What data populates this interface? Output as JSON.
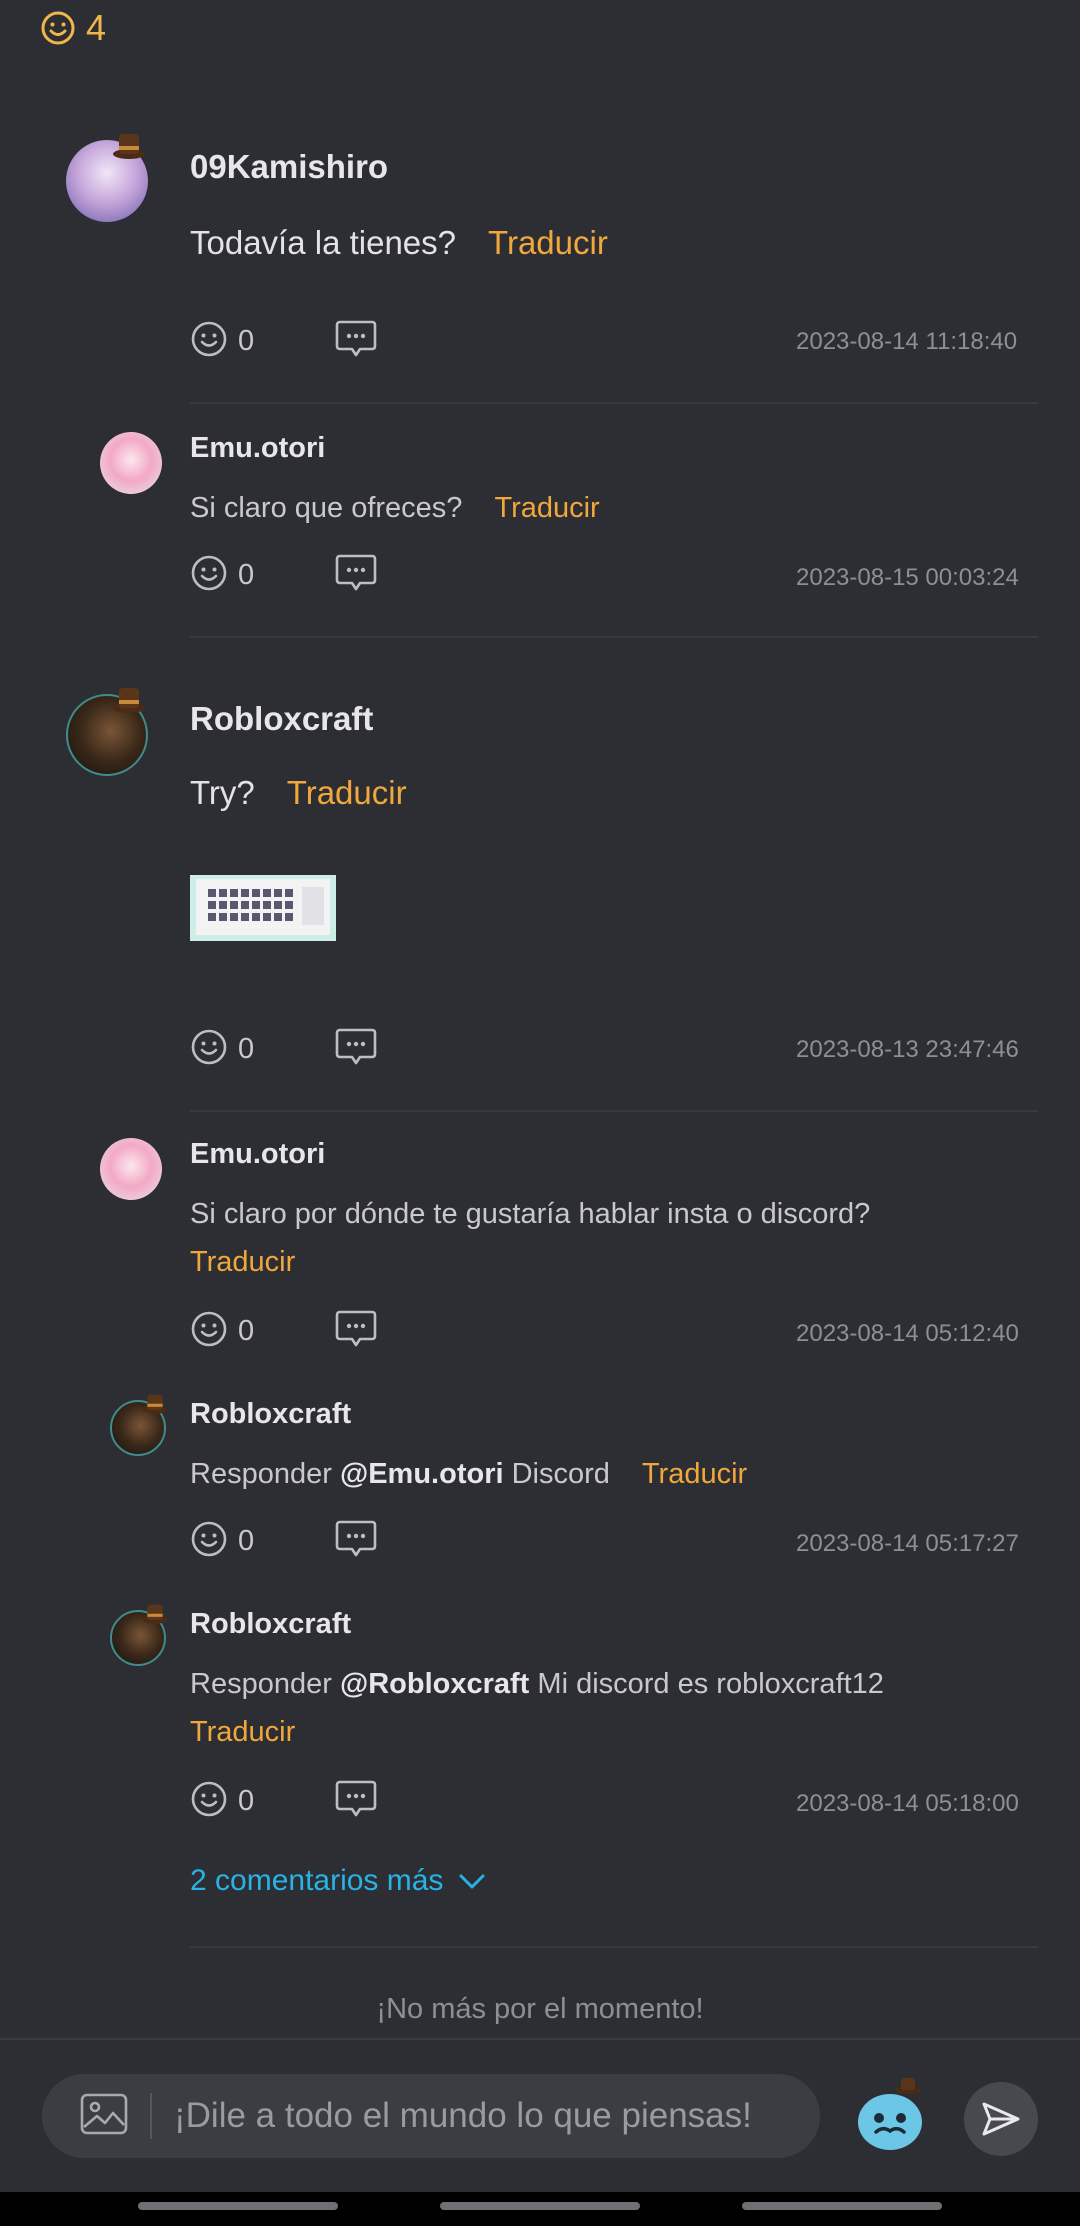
{
  "header": {
    "reaction_count": "4"
  },
  "comments": [
    {
      "username": "09Kamishiro",
      "text": "Todavía la tienes?",
      "translate": "Traducir",
      "likes": "0",
      "timestamp": "2023-08-14 11:18:40"
    },
    {
      "username": "Emu.otori",
      "text": "Si claro que ofreces?",
      "translate": "Traducir",
      "likes": "0",
      "timestamp": "2023-08-15 00:03:24"
    },
    {
      "username": "Robloxcraft",
      "text": "Try?",
      "translate": "Traducir",
      "likes": "0",
      "timestamp": "2023-08-13 23:47:46"
    },
    {
      "username": "Emu.otori",
      "text": "Si claro por dónde te gustaría hablar insta o discord?",
      "translate": "Traducir",
      "likes": "0",
      "timestamp": "2023-08-14 05:12:40"
    },
    {
      "username": "Robloxcraft",
      "reply_prefix": "Responder",
      "mention": "@Emu.otori",
      "text": "Discord",
      "translate": "Traducir",
      "likes": "0",
      "timestamp": "2023-08-14 05:17:27"
    },
    {
      "username": "Robloxcraft",
      "reply_prefix": "Responder",
      "mention": "@Robloxcraft",
      "text": "Mi discord es robloxcraft12",
      "translate": "Traducir",
      "likes": "0",
      "timestamp": "2023-08-14 05:18:00"
    }
  ],
  "more_comments": "2 comentarios más",
  "no_more": "¡No más por el momento!",
  "composer": {
    "placeholder": "¡Dile a todo el mundo lo que piensas!"
  },
  "colors": {
    "accent_translate": "#f0a73c",
    "link": "#28b3e6",
    "background": "#2d2e33"
  }
}
